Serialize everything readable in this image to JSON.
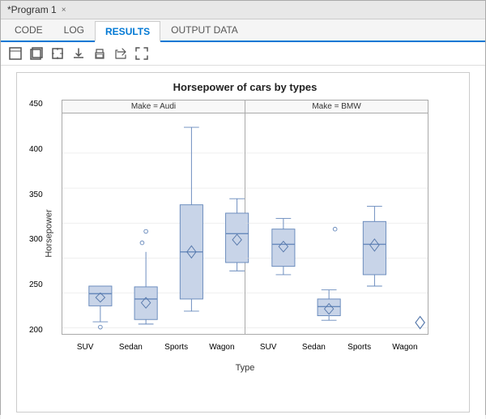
{
  "window": {
    "title": "*Program 1",
    "close_label": "×"
  },
  "tabs": [
    {
      "id": "code",
      "label": "CODE",
      "active": false
    },
    {
      "id": "log",
      "label": "LOG",
      "active": false
    },
    {
      "id": "results",
      "label": "RESULTS",
      "active": true
    },
    {
      "id": "output-data",
      "label": "OUTPUT DATA",
      "active": false
    }
  ],
  "toolbar": {
    "icons": [
      "⊡",
      "⊞",
      "⊟",
      "⬇",
      "🖨",
      "↗",
      "⛶"
    ]
  },
  "chart": {
    "title": "Horsepower of cars by types",
    "y_label": "Horsepower",
    "x_label": "Type",
    "y_ticks": [
      "200",
      "250",
      "300",
      "350",
      "400",
      "450"
    ],
    "panels": [
      {
        "header": "Make = Audi",
        "categories": [
          "SUV",
          "Sedan",
          "Sports",
          "Wagon"
        ]
      },
      {
        "header": "Make = BMW",
        "categories": [
          "SUV",
          "Sedan",
          "Sports",
          "Wagon"
        ]
      }
    ]
  }
}
